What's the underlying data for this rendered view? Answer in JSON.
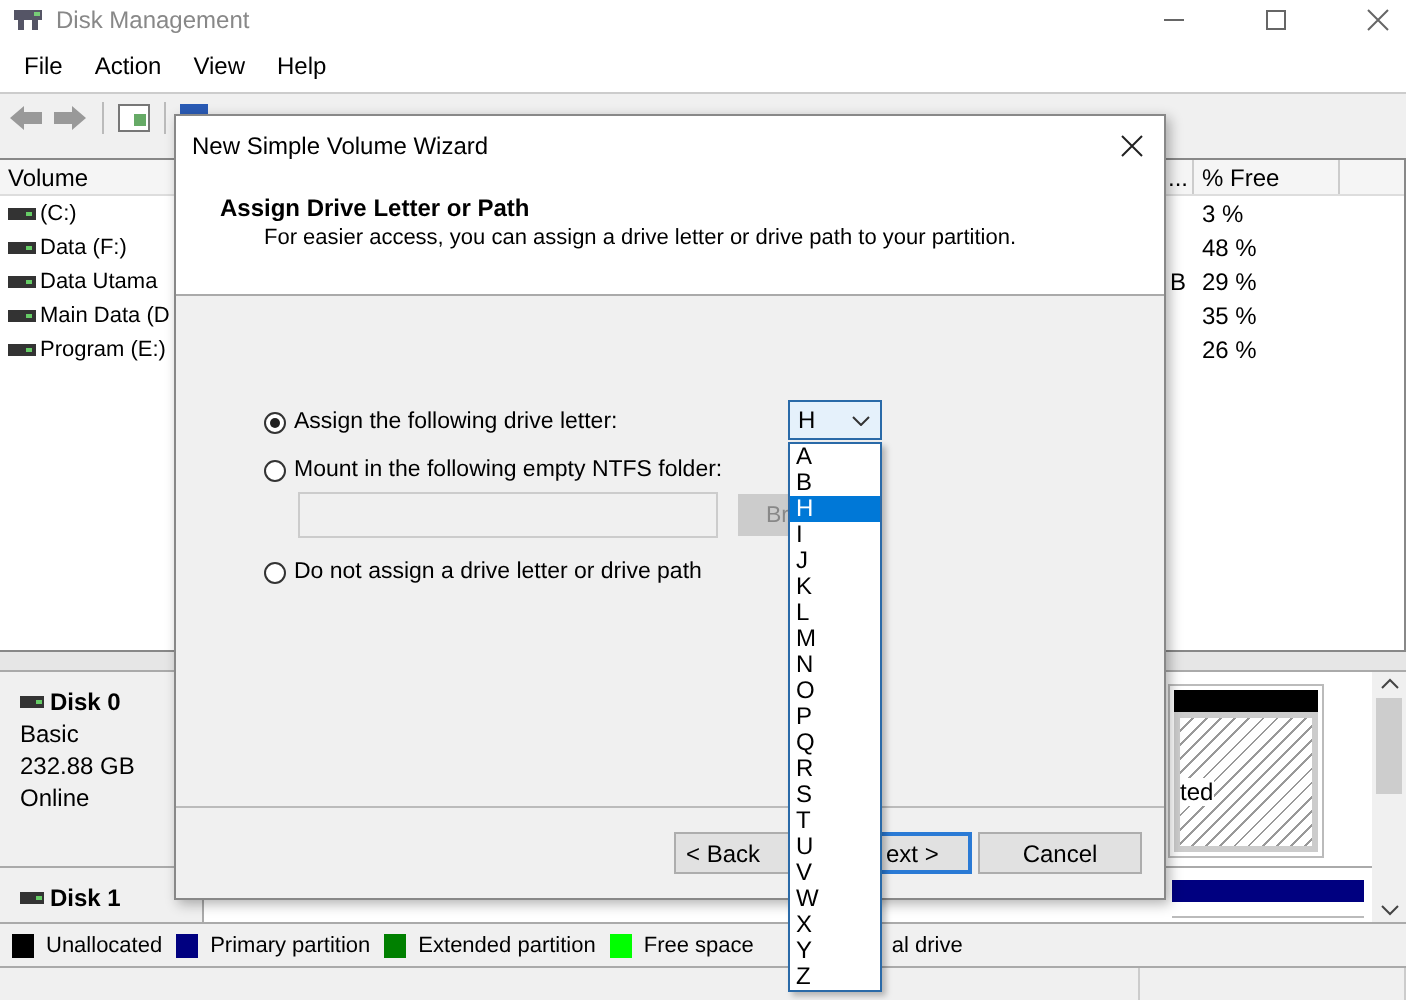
{
  "window": {
    "title": "Disk Management"
  },
  "menu": [
    "File",
    "Action",
    "View",
    "Help"
  ],
  "volume_list": {
    "columns": [
      "Volume",
      "...",
      "% Free"
    ],
    "rows": [
      {
        "volume": "(C:)",
        "free": "3 %"
      },
      {
        "volume": "Data (F:)",
        "free": "48 %"
      },
      {
        "volume": "Data Utama",
        "column_2": "B",
        "free": "29 %"
      },
      {
        "volume": "Main Data (D",
        "free": "35 %"
      },
      {
        "volume": "Program (E:)",
        "free": "26 %"
      }
    ]
  },
  "disks": [
    {
      "name": "Disk 0",
      "type": "Basic",
      "size": "232.88 GB",
      "status": "Online",
      "partition": {
        "label": "ted",
        "color": "#000000"
      }
    },
    {
      "name": "Disk 1",
      "partition": {
        "color": "#000080"
      }
    }
  ],
  "legend": [
    {
      "label": "Unallocated",
      "color": "#000000"
    },
    {
      "label": "Primary partition",
      "color": "#000080"
    },
    {
      "label": "Extended partition",
      "color": "#008000"
    },
    {
      "label": "Free space",
      "color": "#00ff00"
    },
    {
      "label": "al drive"
    }
  ],
  "dialog": {
    "title": "New Simple Volume Wizard",
    "heading": "Assign Drive Letter or Path",
    "subtitle": "For easier access, you can assign a drive letter or drive path to your partition.",
    "options": [
      {
        "label": "Assign the following drive letter:",
        "selected": true
      },
      {
        "label": "Mount in the following empty NTFS folder:",
        "selected": false
      },
      {
        "label": "Do not assign a drive letter or drive path",
        "selected": false
      }
    ],
    "folder_field": {
      "disabled": true
    },
    "browse": {
      "label": "Br",
      "disabled": true
    },
    "drive_letter": {
      "value": "H",
      "expanded": true,
      "letters": [
        {
          "letter": "A",
          "selected": false
        },
        {
          "letter": "B",
          "selected": false
        },
        {
          "letter": "H",
          "selected": true
        },
        {
          "letter": "I",
          "selected": false
        },
        {
          "letter": "J",
          "selected": false
        },
        {
          "letter": "K",
          "selected": false
        },
        {
          "letter": "L",
          "selected": false
        },
        {
          "letter": "M",
          "selected": false
        },
        {
          "letter": "N",
          "selected": false
        },
        {
          "letter": "O",
          "selected": false
        },
        {
          "letter": "P",
          "selected": false
        },
        {
          "letter": "Q",
          "selected": false
        },
        {
          "letter": "R",
          "selected": false
        },
        {
          "letter": "S",
          "selected": false
        },
        {
          "letter": "T",
          "selected": false
        },
        {
          "letter": "U",
          "selected": false
        },
        {
          "letter": "V",
          "selected": false
        },
        {
          "letter": "W",
          "selected": false
        },
        {
          "letter": "X",
          "selected": false
        },
        {
          "letter": "Y",
          "selected": false
        },
        {
          "letter": "Z",
          "selected": false
        }
      ]
    },
    "buttons": [
      {
        "label": "< Back",
        "default": false
      },
      {
        "label": "ext >",
        "default": true
      },
      {
        "label": "Cancel",
        "default": false
      }
    ]
  }
}
